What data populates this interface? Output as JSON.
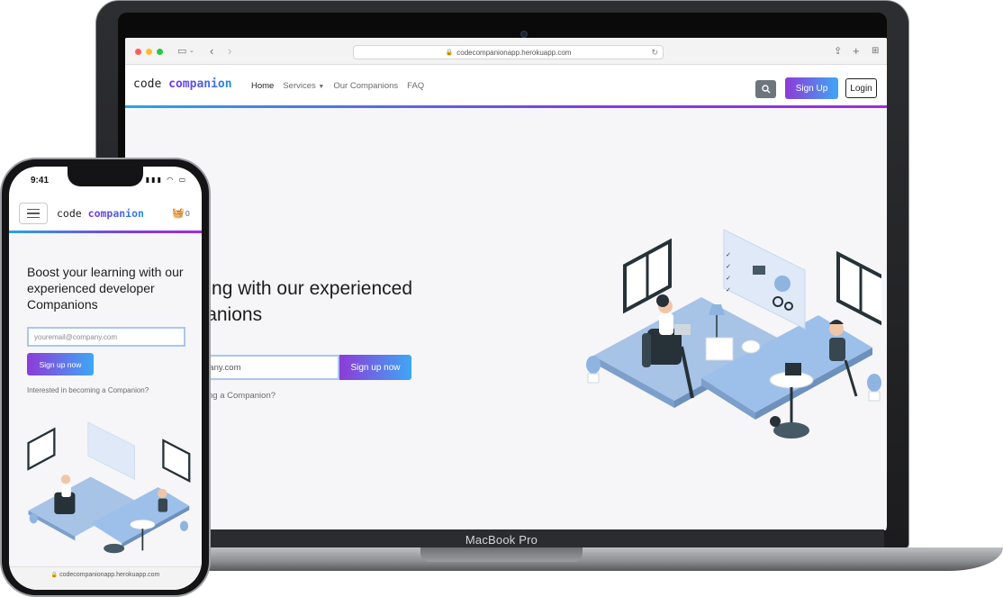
{
  "macbook": {
    "label": "MacBook Pro",
    "browser": {
      "url": "codecompanionapp.herokuapp.com",
      "icons": [
        "sidebar-icon",
        "chevron-down-icon",
        "back-icon",
        "forward-icon",
        "lock-icon",
        "reload-icon",
        "share-icon",
        "new-tab-icon",
        "tab-overview-icon"
      ]
    },
    "site": {
      "logo_word1": "code",
      "logo_word2": "companion",
      "nav": {
        "home": "Home",
        "services": "Services",
        "companions": "Our Companions",
        "faq": "FAQ"
      },
      "search_icon": "search-icon",
      "signup_label": "Sign Up",
      "login_label": "Login",
      "hero": {
        "title_line1": "your learning with our experienced",
        "title_line2": "per Companions",
        "input_value": "pany.com",
        "button_label": "Sign up now",
        "link_text": "ming a Companion?"
      }
    }
  },
  "iphone": {
    "time": "9:41",
    "status_icons": "signal-icon wifi-icon battery-icon",
    "logo_word1": "code",
    "logo_word2": "companion",
    "basket_icon": "basket-icon",
    "basket_count": "0",
    "title": "Boost your learning with our experienced developer Companions",
    "email_placeholder": "youremail@company.com",
    "button_label": "Sign up now",
    "link_text": "Interested in becoming a Companion?",
    "url": "codecompanionapp.herokuapp.com"
  },
  "colors": {
    "brand_purple": "#8e3ad8",
    "brand_blue": "#3ea7f5",
    "illustration_blue": "#8fb4df",
    "dark": "#2b2c2f"
  }
}
